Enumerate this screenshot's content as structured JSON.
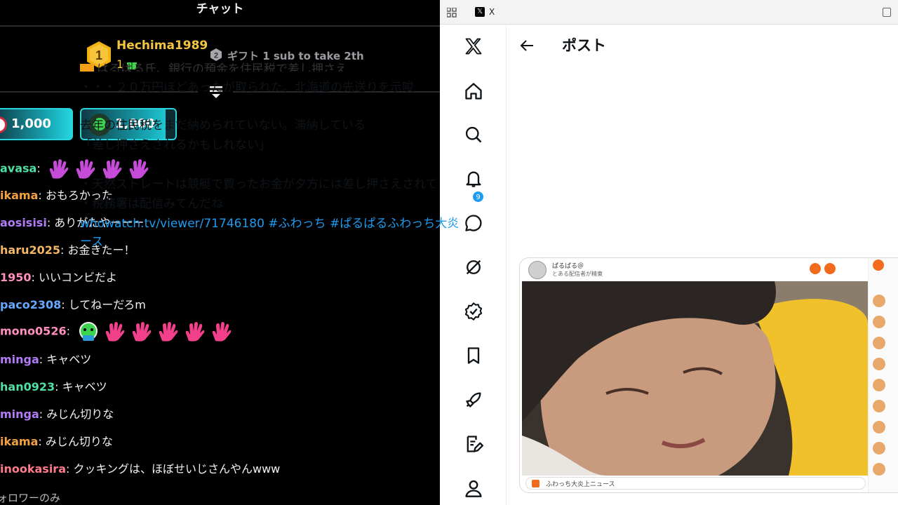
{
  "chat": {
    "title": "チャット",
    "top_gifter": {
      "rank": "1",
      "name": "Hechima1989",
      "count": "1"
    },
    "rank2": {
      "rank": "2",
      "text": "ギフト 1 sub to take 2th"
    },
    "pills": [
      {
        "amount": "1,000"
      },
      {
        "amount": "1,000"
      }
    ],
    "messages": [
      {
        "user": "avasa",
        "sep": ": ",
        "text": "",
        "color": "#4fe0a6",
        "emotes": [
          "hand",
          "hand",
          "hand",
          "hand"
        ],
        "emote_color": "#c54bd8"
      },
      {
        "user": "ikama",
        "sep": ": ",
        "text": "おもろかった",
        "color": "#f5a142"
      },
      {
        "user": "aosisisi",
        "sep": ": ",
        "text": "ありがたやーーー",
        "color": "#b27cf7"
      },
      {
        "user": "haru2025",
        "sep": ": ",
        "text": "お金きたー！",
        "color": "#f5b766"
      },
      {
        "user": "1950",
        "sep": ": ",
        "text": "いいコンビだよ",
        "color": "#ff8fbd"
      },
      {
        "user": "paco2308",
        "sep": ": ",
        "text": "してねーだろm",
        "color": "#66a8ff"
      },
      {
        "user": "mono0526",
        "sep": ": ",
        "text": "",
        "color": "#ff8fbd",
        "emotes": [
          "face",
          "hand",
          "hand",
          "hand",
          "hand",
          "hand"
        ],
        "emote_color": "#f2418a"
      },
      {
        "user": "minga",
        "sep": ": ",
        "text": "キャベツ",
        "color": "#b27cf7"
      },
      {
        "user": "han0923",
        "sep": ": ",
        "text": "キャベツ",
        "color": "#4fe0a6"
      },
      {
        "user": "minga",
        "sep": ": ",
        "text": "みじん切りな",
        "color": "#b27cf7"
      },
      {
        "user": "ikama",
        "sep": ": ",
        "text": "みじん切りな",
        "color": "#f5a142"
      },
      {
        "user": "inookasira",
        "sep": ": ",
        "text": "クッキングは、ほぼせいじさんやんwww",
        "color": "#ff7a8a"
      }
    ],
    "footer": "ォロワーのみ"
  },
  "browser": {
    "tab_title": "X",
    "tab_favicon": "𝕏",
    "notification_count": "9",
    "nav_icons": [
      "x-logo-icon",
      "home-icon",
      "search-icon",
      "notifications-icon",
      "messages-icon",
      "grok-icon",
      "verified-icon",
      "bookmarks-icon",
      "rocket-icon",
      "compose-icon",
      "profile-icon"
    ],
    "post": {
      "header_title": "ポスト",
      "lines": [
        "はるはる氏、銀行の預金を住民税で差し押さえ",
        "・・・２０万円ほどあったが取られた。北海道の先送りを示唆",
        "",
        "去年の住民税をまだ納められていない。滞納している",
        "「差し押さえされるかもしれない」",
        "",
        "・天然ストレートは競艇で買ったお金が夕方には差し押さえされて",
        "・税務署は配信みてんだね"
      ],
      "link_1": "whowatch.tv/viewer/71746180",
      "link_2": " #ふわっち",
      "link_3": " #ぱるぱるふわっち大炎",
      "link_4": "ース",
      "video_card": {
        "channel": "ぱるぱる＠",
        "subtitle": "とある配信者が精東",
        "caption": "ふわっち大炎上ニュース"
      }
    }
  }
}
